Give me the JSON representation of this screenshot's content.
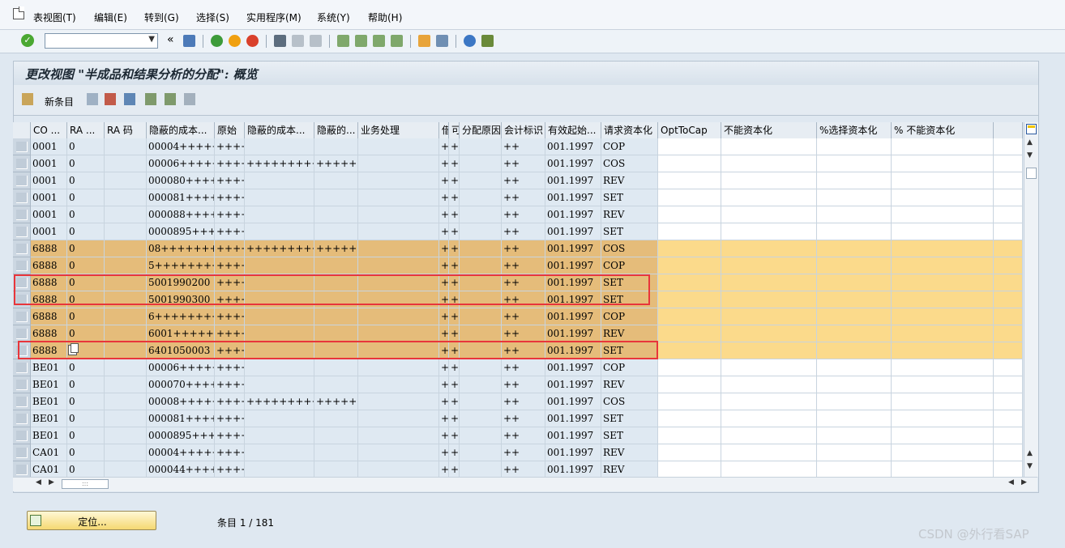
{
  "menu": [
    "表视图(T)",
    "编辑(E)",
    "转到(G)",
    "选择(S)",
    "实用程序(M)",
    "系统(Y)",
    "帮助(H)"
  ],
  "toolbar": {
    "command_value": "",
    "nav_back": "«"
  },
  "title": "更改视图 \"半成品和结果分析的分配\": 概览",
  "app_toolbar": {
    "new_entries": "新条目"
  },
  "columns": [
    "CO ...",
    "RA ...",
    "RA 码",
    "隐蔽的成本...",
    "原始",
    "隐蔽的成本...",
    "隐蔽的...",
    "业务处理",
    "借",
    "可",
    "分配原因",
    "会计标识",
    "有效起始...",
    "请求资本化",
    "OptToCap",
    "不能资本化",
    "%选择资本化",
    "% 不能资本化"
  ],
  "rows": [
    {
      "co": "0001",
      "ra": "0",
      "racode": "",
      "cost1": "00004+++++",
      "orig": "++++",
      "cost2": "",
      "cost3": "",
      "biz": "",
      "d": "+",
      "c": "+",
      "reason": "",
      "acct": "++",
      "valid": "001.1997",
      "req": "COP",
      "hl": false
    },
    {
      "co": "0001",
      "ra": "0",
      "racode": "",
      "cost1": "00006+++++",
      "orig": "++++",
      "cost2": "++++++++++",
      "cost3": "++++++",
      "biz": "",
      "d": "+",
      "c": "+",
      "reason": "",
      "acct": "++",
      "valid": "001.1997",
      "req": "COS",
      "hl": false
    },
    {
      "co": "0001",
      "ra": "0",
      "racode": "",
      "cost1": "000080++++",
      "orig": "++++",
      "cost2": "",
      "cost3": "",
      "biz": "",
      "d": "+",
      "c": "+",
      "reason": "",
      "acct": "++",
      "valid": "001.1997",
      "req": "REV",
      "hl": false
    },
    {
      "co": "0001",
      "ra": "0",
      "racode": "",
      "cost1": "000081++++",
      "orig": "++++",
      "cost2": "",
      "cost3": "",
      "biz": "",
      "d": "+",
      "c": "+",
      "reason": "",
      "acct": "++",
      "valid": "001.1997",
      "req": "SET",
      "hl": false
    },
    {
      "co": "0001",
      "ra": "0",
      "racode": "",
      "cost1": "000088++++",
      "orig": "++++",
      "cost2": "",
      "cost3": "",
      "biz": "",
      "d": "+",
      "c": "+",
      "reason": "",
      "acct": "++",
      "valid": "001.1997",
      "req": "REV",
      "hl": false
    },
    {
      "co": "0001",
      "ra": "0",
      "racode": "",
      "cost1": "0000895+++",
      "orig": "++++",
      "cost2": "",
      "cost3": "",
      "biz": "",
      "d": "+",
      "c": "+",
      "reason": "",
      "acct": "++",
      "valid": "001.1997",
      "req": "SET",
      "hl": false
    },
    {
      "co": "6888",
      "ra": "0",
      "racode": "",
      "cost1": "08++++++++",
      "orig": "++++",
      "cost2": "++++++++++",
      "cost3": "++++++",
      "biz": "",
      "d": "+",
      "c": "+",
      "reason": "",
      "acct": "++",
      "valid": "001.1997",
      "req": "COS",
      "hl": true
    },
    {
      "co": "6888",
      "ra": "0",
      "racode": "",
      "cost1": "5+++++++++",
      "orig": "++++",
      "cost2": "",
      "cost3": "",
      "biz": "",
      "d": "+",
      "c": "+",
      "reason": "",
      "acct": "++",
      "valid": "001.1997",
      "req": "COP",
      "hl": true
    },
    {
      "co": "6888",
      "ra": "0",
      "racode": "",
      "cost1": "5001990200",
      "orig": "++++",
      "cost2": "",
      "cost3": "",
      "biz": "",
      "d": "+",
      "c": "+",
      "reason": "",
      "acct": "++",
      "valid": "001.1997",
      "req": "SET",
      "hl": true
    },
    {
      "co": "6888",
      "ra": "0",
      "racode": "",
      "cost1": "5001990300",
      "orig": "++++",
      "cost2": "",
      "cost3": "",
      "biz": "",
      "d": "+",
      "c": "+",
      "reason": "",
      "acct": "++",
      "valid": "001.1997",
      "req": "SET",
      "hl": true
    },
    {
      "co": "6888",
      "ra": "0",
      "racode": "",
      "cost1": "6+++++++++",
      "orig": "++++",
      "cost2": "",
      "cost3": "",
      "biz": "",
      "d": "+",
      "c": "+",
      "reason": "",
      "acct": "++",
      "valid": "001.1997",
      "req": "COP",
      "hl": true
    },
    {
      "co": "6888",
      "ra": "0",
      "racode": "",
      "cost1": "6001++++++",
      "orig": "++++",
      "cost2": "",
      "cost3": "",
      "biz": "",
      "d": "+",
      "c": "+",
      "reason": "",
      "acct": "++",
      "valid": "001.1997",
      "req": "REV",
      "hl": true
    },
    {
      "co": "6888",
      "ra": "",
      "racode": "",
      "cost1": "6401050003",
      "orig": "++++",
      "cost2": "",
      "cost3": "",
      "biz": "",
      "d": "+",
      "c": "+",
      "reason": "",
      "acct": "++",
      "valid": "001.1997",
      "req": "SET",
      "hl": true,
      "copyicon": true
    },
    {
      "co": "BE01",
      "ra": "0",
      "racode": "",
      "cost1": "00006+++++",
      "orig": "++++",
      "cost2": "",
      "cost3": "",
      "biz": "",
      "d": "+",
      "c": "+",
      "reason": "",
      "acct": "++",
      "valid": "001.1997",
      "req": "COP",
      "hl": false
    },
    {
      "co": "BE01",
      "ra": "0",
      "racode": "",
      "cost1": "000070++++",
      "orig": "++++",
      "cost2": "",
      "cost3": "",
      "biz": "",
      "d": "+",
      "c": "+",
      "reason": "",
      "acct": "++",
      "valid": "001.1997",
      "req": "REV",
      "hl": false
    },
    {
      "co": "BE01",
      "ra": "0",
      "racode": "",
      "cost1": "00008+++++",
      "orig": "++++",
      "cost2": "++++++++++",
      "cost3": "++++++",
      "biz": "",
      "d": "+",
      "c": "+",
      "reason": "",
      "acct": "++",
      "valid": "001.1997",
      "req": "COS",
      "hl": false
    },
    {
      "co": "BE01",
      "ra": "0",
      "racode": "",
      "cost1": "000081++++",
      "orig": "++++",
      "cost2": "",
      "cost3": "",
      "biz": "",
      "d": "+",
      "c": "+",
      "reason": "",
      "acct": "++",
      "valid": "001.1997",
      "req": "SET",
      "hl": false
    },
    {
      "co": "BE01",
      "ra": "0",
      "racode": "",
      "cost1": "0000895+++",
      "orig": "++++",
      "cost2": "",
      "cost3": "",
      "biz": "",
      "d": "+",
      "c": "+",
      "reason": "",
      "acct": "++",
      "valid": "001.1997",
      "req": "SET",
      "hl": false
    },
    {
      "co": "CA01",
      "ra": "0",
      "racode": "",
      "cost1": "00004+++++",
      "orig": "++++",
      "cost2": "",
      "cost3": "",
      "biz": "",
      "d": "+",
      "c": "+",
      "reason": "",
      "acct": "++",
      "valid": "001.1997",
      "req": "REV",
      "hl": false
    },
    {
      "co": "CA01",
      "ra": "0",
      "racode": "",
      "cost1": "000044++++",
      "orig": "++++",
      "cost2": "",
      "cost3": "",
      "biz": "",
      "d": "+",
      "c": "+",
      "reason": "",
      "acct": "++",
      "valid": "001.1997",
      "req": "REV",
      "hl": false
    }
  ],
  "footer": {
    "position_button": "定位...",
    "entries": "条目 1 / 181"
  },
  "watermark": "CSDN @外行看SAP",
  "colors": {
    "highlight_readonly": "#e5bc7a",
    "highlight_editable": "#fbda8b",
    "readonly_cell": "#dfe9f2",
    "annotation_red": "#e8353b"
  }
}
